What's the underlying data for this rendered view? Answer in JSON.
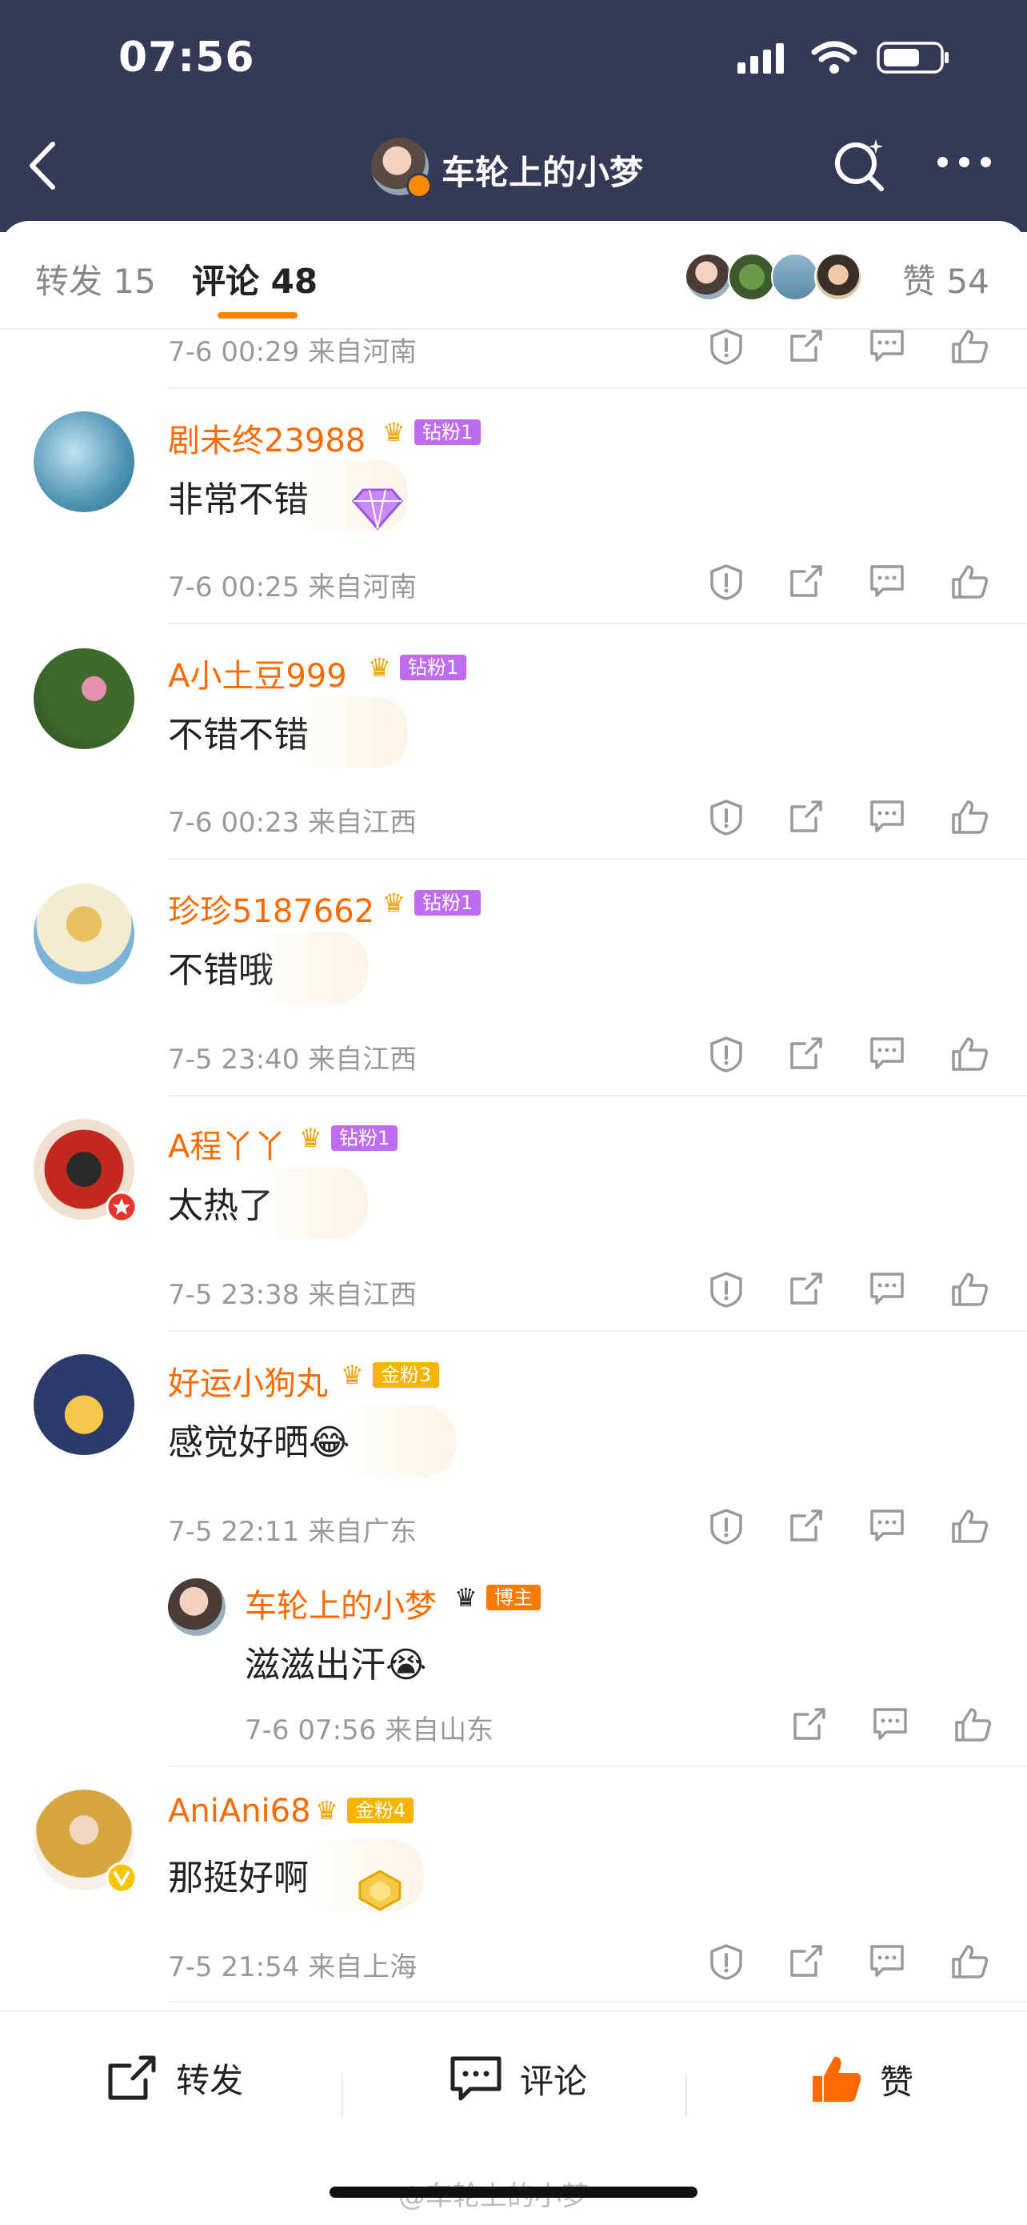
{
  "status_bar": {
    "time": "07:56"
  },
  "nav": {
    "title": "车轮上的小梦"
  },
  "tabs": {
    "forward": "转发 15",
    "comments": "评论 48",
    "likes": "赞 54"
  },
  "top_meta": {
    "meta": "7-6 00:29  来自河南"
  },
  "comments": [
    {
      "name": "剧未终23988",
      "badge": "钻粉1",
      "level": "4",
      "text": "非常不错",
      "meta": "7-6 00:25  来自河南"
    },
    {
      "name": "A小土豆999",
      "badge": "钻粉1",
      "level": "4",
      "text": "不错不错",
      "meta": "7-6 00:23  来自江西"
    },
    {
      "name": "珍珍5187662",
      "badge": "钻粉1",
      "level": "4",
      "text": "不错哦",
      "meta": "7-5 23:40  来自江西"
    },
    {
      "name": "A程丫丫",
      "badge": "钻粉1",
      "level": "4",
      "text": "太热了",
      "meta": "7-5 23:38  来自江西"
    },
    {
      "name": "好运小狗丸",
      "badge": "金粉3",
      "level": "4",
      "text": "感觉好晒😂",
      "meta": "7-5 22:11  来自广东"
    },
    {
      "name": "AniAni68",
      "badge": "金粉4",
      "level": "6",
      "text": "那挺好啊",
      "meta": "7-5 21:54  来自上海"
    }
  ],
  "reply": {
    "name": "车轮上的小梦",
    "badge": "博主",
    "text": "滋滋出汗😭",
    "meta": "7-6 07:56  来自山东"
  },
  "footer": {
    "forward": "转发",
    "comment": "评论",
    "like": "赞"
  },
  "watermark": "@车轮上的小梦",
  "colors": {
    "header": "#343a55",
    "accent": "#ff8200",
    "name": "#ff6a00",
    "diamond_badge": "#c06cf0",
    "gold_badge": "#f5b400",
    "blogger_badge": "#ff7a00"
  }
}
